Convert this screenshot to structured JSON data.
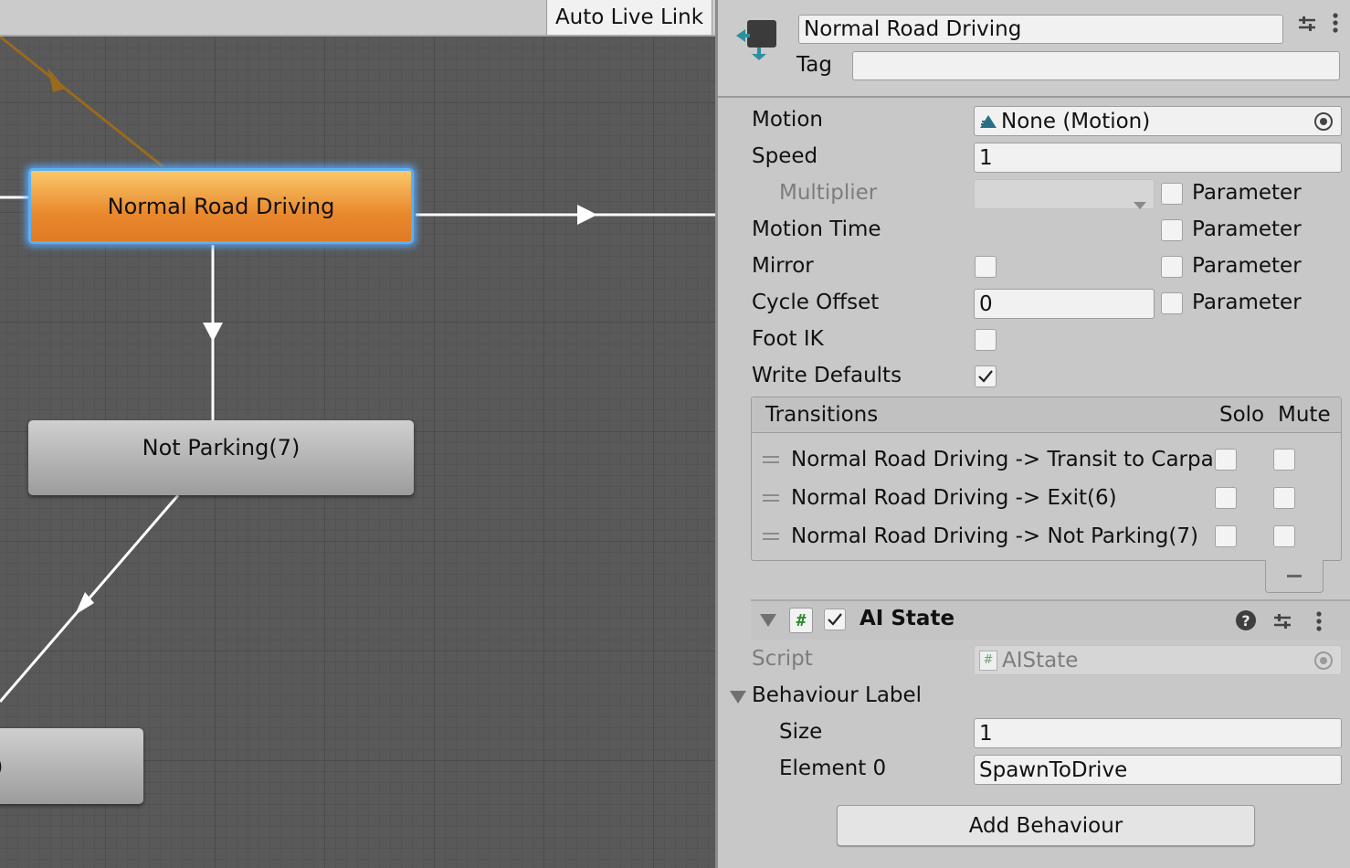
{
  "graph": {
    "auto_live_link": "Auto Live Link",
    "nodes": {
      "active": "Normal Road Driving",
      "not_parking": "Not Parking(7)",
      "partial": ")"
    }
  },
  "inspector": {
    "state_name": "Normal Road Driving",
    "tag_label": "Tag",
    "tag_value": "",
    "motion": {
      "label": "Motion",
      "value": "None (Motion)"
    },
    "speed": {
      "label": "Speed",
      "value": "1"
    },
    "multiplier": {
      "label": "Multiplier",
      "value": "",
      "parameter_label": "Parameter",
      "parameter_checked": false
    },
    "motion_time": {
      "label": "Motion Time",
      "parameter_label": "Parameter",
      "parameter_checked": false
    },
    "mirror": {
      "label": "Mirror",
      "checked": false,
      "parameter_label": "Parameter",
      "parameter_checked": false
    },
    "cycle_offset": {
      "label": "Cycle Offset",
      "value": "0",
      "parameter_label": "Parameter",
      "parameter_checked": false
    },
    "foot_ik": {
      "label": "Foot IK",
      "checked": false
    },
    "write_defaults": {
      "label": "Write Defaults",
      "checked": true
    },
    "transitions": {
      "header": "Transitions",
      "solo_label": "Solo",
      "mute_label": "Mute",
      "items": [
        {
          "label": "Normal Road Driving -> Transit to Carparl",
          "solo": false,
          "mute": false
        },
        {
          "label": "Normal Road Driving -> Exit(6)",
          "solo": false,
          "mute": false
        },
        {
          "label": "Normal Road Driving -> Not Parking(7)",
          "solo": false,
          "mute": false
        }
      ]
    },
    "component": {
      "title": "AI State",
      "enabled": true,
      "script_label": "Script",
      "script_value": "AIState",
      "behaviour_label": "Behaviour Label",
      "size_label": "Size",
      "size_value": "1",
      "element_label": "Element 0",
      "element_value": "SpawnToDrive"
    },
    "add_behaviour": "Add Behaviour"
  },
  "colors": {
    "active_node": "#e9892d",
    "selection_glow": "#5bb0f5",
    "incoming_edge": "#9a6a1e",
    "edge": "#ffffff"
  }
}
